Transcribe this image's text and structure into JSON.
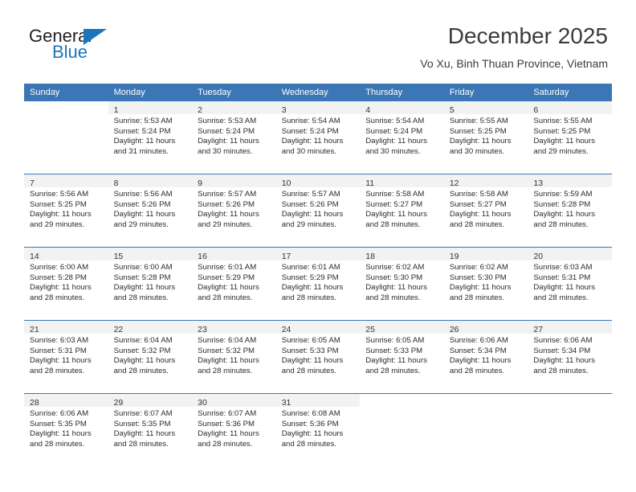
{
  "brand": {
    "name_part1": "General",
    "name_part2": "Blue",
    "flag_icon": "triangle-flag-icon",
    "accent_color": "#1b75bb"
  },
  "header": {
    "title": "December 2025",
    "subtitle": "Vo Xu, Binh Thuan Province, Vietnam"
  },
  "theme": {
    "header_row_bg": "#3b77b5",
    "daynum_band_bg": "#f2f2f2",
    "grid_line": "#3b77b5",
    "text": "#2b2b2b"
  },
  "calendar": {
    "weekday_headers": [
      "Sunday",
      "Monday",
      "Tuesday",
      "Wednesday",
      "Thursday",
      "Friday",
      "Saturday"
    ],
    "weeks": [
      [
        {
          "day": "",
          "sunrise": "",
          "sunset": "",
          "daylight_line1": "",
          "daylight_line2": ""
        },
        {
          "day": "1",
          "sunrise": "Sunrise: 5:53 AM",
          "sunset": "Sunset: 5:24 PM",
          "daylight_line1": "Daylight: 11 hours",
          "daylight_line2": "and 31 minutes."
        },
        {
          "day": "2",
          "sunrise": "Sunrise: 5:53 AM",
          "sunset": "Sunset: 5:24 PM",
          "daylight_line1": "Daylight: 11 hours",
          "daylight_line2": "and 30 minutes."
        },
        {
          "day": "3",
          "sunrise": "Sunrise: 5:54 AM",
          "sunset": "Sunset: 5:24 PM",
          "daylight_line1": "Daylight: 11 hours",
          "daylight_line2": "and 30 minutes."
        },
        {
          "day": "4",
          "sunrise": "Sunrise: 5:54 AM",
          "sunset": "Sunset: 5:24 PM",
          "daylight_line1": "Daylight: 11 hours",
          "daylight_line2": "and 30 minutes."
        },
        {
          "day": "5",
          "sunrise": "Sunrise: 5:55 AM",
          "sunset": "Sunset: 5:25 PM",
          "daylight_line1": "Daylight: 11 hours",
          "daylight_line2": "and 30 minutes."
        },
        {
          "day": "6",
          "sunrise": "Sunrise: 5:55 AM",
          "sunset": "Sunset: 5:25 PM",
          "daylight_line1": "Daylight: 11 hours",
          "daylight_line2": "and 29 minutes."
        }
      ],
      [
        {
          "day": "7",
          "sunrise": "Sunrise: 5:56 AM",
          "sunset": "Sunset: 5:25 PM",
          "daylight_line1": "Daylight: 11 hours",
          "daylight_line2": "and 29 minutes."
        },
        {
          "day": "8",
          "sunrise": "Sunrise: 5:56 AM",
          "sunset": "Sunset: 5:26 PM",
          "daylight_line1": "Daylight: 11 hours",
          "daylight_line2": "and 29 minutes."
        },
        {
          "day": "9",
          "sunrise": "Sunrise: 5:57 AM",
          "sunset": "Sunset: 5:26 PM",
          "daylight_line1": "Daylight: 11 hours",
          "daylight_line2": "and 29 minutes."
        },
        {
          "day": "10",
          "sunrise": "Sunrise: 5:57 AM",
          "sunset": "Sunset: 5:26 PM",
          "daylight_line1": "Daylight: 11 hours",
          "daylight_line2": "and 29 minutes."
        },
        {
          "day": "11",
          "sunrise": "Sunrise: 5:58 AM",
          "sunset": "Sunset: 5:27 PM",
          "daylight_line1": "Daylight: 11 hours",
          "daylight_line2": "and 28 minutes."
        },
        {
          "day": "12",
          "sunrise": "Sunrise: 5:58 AM",
          "sunset": "Sunset: 5:27 PM",
          "daylight_line1": "Daylight: 11 hours",
          "daylight_line2": "and 28 minutes."
        },
        {
          "day": "13",
          "sunrise": "Sunrise: 5:59 AM",
          "sunset": "Sunset: 5:28 PM",
          "daylight_line1": "Daylight: 11 hours",
          "daylight_line2": "and 28 minutes."
        }
      ],
      [
        {
          "day": "14",
          "sunrise": "Sunrise: 6:00 AM",
          "sunset": "Sunset: 5:28 PM",
          "daylight_line1": "Daylight: 11 hours",
          "daylight_line2": "and 28 minutes."
        },
        {
          "day": "15",
          "sunrise": "Sunrise: 6:00 AM",
          "sunset": "Sunset: 5:28 PM",
          "daylight_line1": "Daylight: 11 hours",
          "daylight_line2": "and 28 minutes."
        },
        {
          "day": "16",
          "sunrise": "Sunrise: 6:01 AM",
          "sunset": "Sunset: 5:29 PM",
          "daylight_line1": "Daylight: 11 hours",
          "daylight_line2": "and 28 minutes."
        },
        {
          "day": "17",
          "sunrise": "Sunrise: 6:01 AM",
          "sunset": "Sunset: 5:29 PM",
          "daylight_line1": "Daylight: 11 hours",
          "daylight_line2": "and 28 minutes."
        },
        {
          "day": "18",
          "sunrise": "Sunrise: 6:02 AM",
          "sunset": "Sunset: 5:30 PM",
          "daylight_line1": "Daylight: 11 hours",
          "daylight_line2": "and 28 minutes."
        },
        {
          "day": "19",
          "sunrise": "Sunrise: 6:02 AM",
          "sunset": "Sunset: 5:30 PM",
          "daylight_line1": "Daylight: 11 hours",
          "daylight_line2": "and 28 minutes."
        },
        {
          "day": "20",
          "sunrise": "Sunrise: 6:03 AM",
          "sunset": "Sunset: 5:31 PM",
          "daylight_line1": "Daylight: 11 hours",
          "daylight_line2": "and 28 minutes."
        }
      ],
      [
        {
          "day": "21",
          "sunrise": "Sunrise: 6:03 AM",
          "sunset": "Sunset: 5:31 PM",
          "daylight_line1": "Daylight: 11 hours",
          "daylight_line2": "and 28 minutes."
        },
        {
          "day": "22",
          "sunrise": "Sunrise: 6:04 AM",
          "sunset": "Sunset: 5:32 PM",
          "daylight_line1": "Daylight: 11 hours",
          "daylight_line2": "and 28 minutes."
        },
        {
          "day": "23",
          "sunrise": "Sunrise: 6:04 AM",
          "sunset": "Sunset: 5:32 PM",
          "daylight_line1": "Daylight: 11 hours",
          "daylight_line2": "and 28 minutes."
        },
        {
          "day": "24",
          "sunrise": "Sunrise: 6:05 AM",
          "sunset": "Sunset: 5:33 PM",
          "daylight_line1": "Daylight: 11 hours",
          "daylight_line2": "and 28 minutes."
        },
        {
          "day": "25",
          "sunrise": "Sunrise: 6:05 AM",
          "sunset": "Sunset: 5:33 PM",
          "daylight_line1": "Daylight: 11 hours",
          "daylight_line2": "and 28 minutes."
        },
        {
          "day": "26",
          "sunrise": "Sunrise: 6:06 AM",
          "sunset": "Sunset: 5:34 PM",
          "daylight_line1": "Daylight: 11 hours",
          "daylight_line2": "and 28 minutes."
        },
        {
          "day": "27",
          "sunrise": "Sunrise: 6:06 AM",
          "sunset": "Sunset: 5:34 PM",
          "daylight_line1": "Daylight: 11 hours",
          "daylight_line2": "and 28 minutes."
        }
      ],
      [
        {
          "day": "28",
          "sunrise": "Sunrise: 6:06 AM",
          "sunset": "Sunset: 5:35 PM",
          "daylight_line1": "Daylight: 11 hours",
          "daylight_line2": "and 28 minutes."
        },
        {
          "day": "29",
          "sunrise": "Sunrise: 6:07 AM",
          "sunset": "Sunset: 5:35 PM",
          "daylight_line1": "Daylight: 11 hours",
          "daylight_line2": "and 28 minutes."
        },
        {
          "day": "30",
          "sunrise": "Sunrise: 6:07 AM",
          "sunset": "Sunset: 5:36 PM",
          "daylight_line1": "Daylight: 11 hours",
          "daylight_line2": "and 28 minutes."
        },
        {
          "day": "31",
          "sunrise": "Sunrise: 6:08 AM",
          "sunset": "Sunset: 5:36 PM",
          "daylight_line1": "Daylight: 11 hours",
          "daylight_line2": "and 28 minutes."
        },
        {
          "day": "",
          "sunrise": "",
          "sunset": "",
          "daylight_line1": "",
          "daylight_line2": ""
        },
        {
          "day": "",
          "sunrise": "",
          "sunset": "",
          "daylight_line1": "",
          "daylight_line2": ""
        },
        {
          "day": "",
          "sunrise": "",
          "sunset": "",
          "daylight_line1": "",
          "daylight_line2": ""
        }
      ]
    ]
  }
}
